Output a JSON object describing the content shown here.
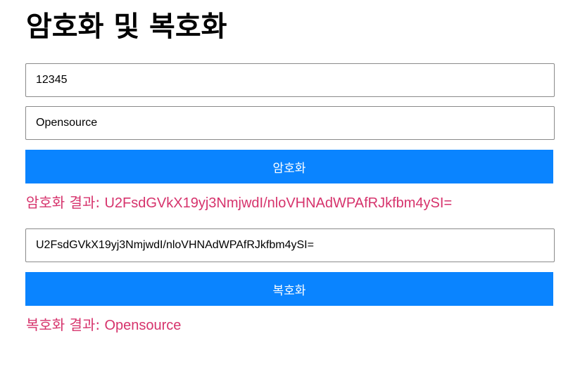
{
  "page": {
    "title": "암호화 및 복호화"
  },
  "form": {
    "key_value": "12345",
    "plaintext_value": "Opensource",
    "ciphertext_value": "U2FsdGVkX19yj3NmjwdI/nloVHNAdWPAfRJkfbm4ySI=",
    "encrypt_label": "암호화",
    "decrypt_label": "복호화"
  },
  "results": {
    "encrypt_prefix": "암호화 결과: ",
    "encrypt_value": "U2FsdGVkX19yj3NmjwdI/nloVHNAdWPAfRJkfbm4ySI=",
    "decrypt_prefix": "복호화 결과: ",
    "decrypt_value": "Opensource"
  },
  "colors": {
    "button_background": "#0a84ff",
    "result_text": "#d6336c",
    "title_text": "#000000"
  }
}
